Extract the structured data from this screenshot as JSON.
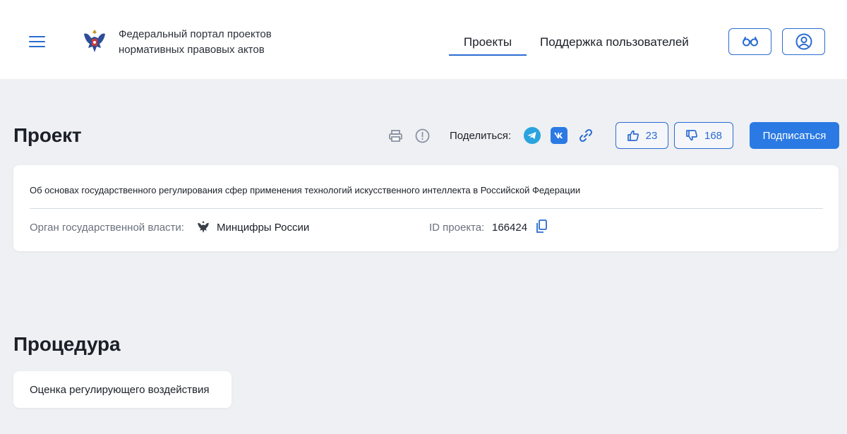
{
  "header": {
    "portal_title_line1": "Федеральный портал проектов",
    "portal_title_line2": "нормативных правовых актов",
    "nav": [
      {
        "label": "Проекты",
        "active": true
      },
      {
        "label": "Поддержка пользователей",
        "active": false
      }
    ],
    "icons": {
      "menu": "hamburger-icon",
      "emblem": "coat-of-arms",
      "accessibility": "glasses-icon",
      "profile": "user-icon"
    }
  },
  "project": {
    "heading": "Проект",
    "share_label": "Поделиться:",
    "share_icons": [
      "telegram-icon",
      "vk-icon",
      "link-icon"
    ],
    "toolbar_icons": [
      "print-icon",
      "report-icon"
    ],
    "likes": "23",
    "dislikes": "168",
    "subscribe_label": "Подписаться",
    "title": "Об основах государственного регулирования сфер применения технологий искусственного интеллекта в Российской Федерации",
    "authority_label": "Орган государственной власти:",
    "authority_value": "Минцифры России",
    "id_label": "ID проекта:",
    "id_value": "166424"
  },
  "procedure": {
    "heading": "Процедура",
    "stage": "Оценка регулирующего воздействия"
  },
  "colors": {
    "accent": "#2b7ae4",
    "background": "#eef0f3",
    "card": "#ffffff",
    "text": "#1b1f27",
    "muted": "#6a717c"
  }
}
